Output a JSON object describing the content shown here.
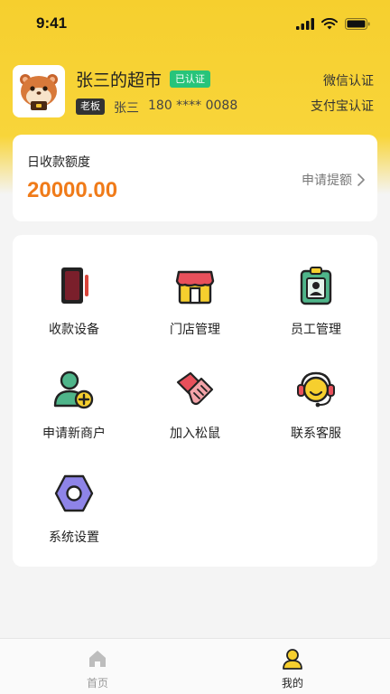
{
  "status_bar": {
    "time": "9:41"
  },
  "profile": {
    "store_name": "张三的超市",
    "verified_badge": "已认证",
    "role_badge": "老板",
    "owner_name": "张三",
    "owner_phone": "180 **** 0088",
    "wechat_auth": "微信认证",
    "alipay_auth": "支付宝认证"
  },
  "quota": {
    "label": "日收款额度",
    "value": "20000.00",
    "apply_label": "申请提额"
  },
  "menu": {
    "items": [
      {
        "label": "收款设备",
        "icon": "payment-device-icon"
      },
      {
        "label": "门店管理",
        "icon": "store-icon"
      },
      {
        "label": "员工管理",
        "icon": "employee-badge-icon"
      },
      {
        "label": "申请新商户",
        "icon": "add-merchant-icon"
      },
      {
        "label": "加入松鼠",
        "icon": "handshake-icon"
      },
      {
        "label": "联系客服",
        "icon": "customer-service-icon"
      },
      {
        "label": "系统设置",
        "icon": "settings-hex-icon"
      }
    ]
  },
  "tabbar": {
    "home_label": "首页",
    "mine_label": "我的"
  },
  "colors": {
    "brand_yellow": "#f6cf2e",
    "quota_orange": "#f07b19",
    "verified_green": "#27c47a"
  }
}
